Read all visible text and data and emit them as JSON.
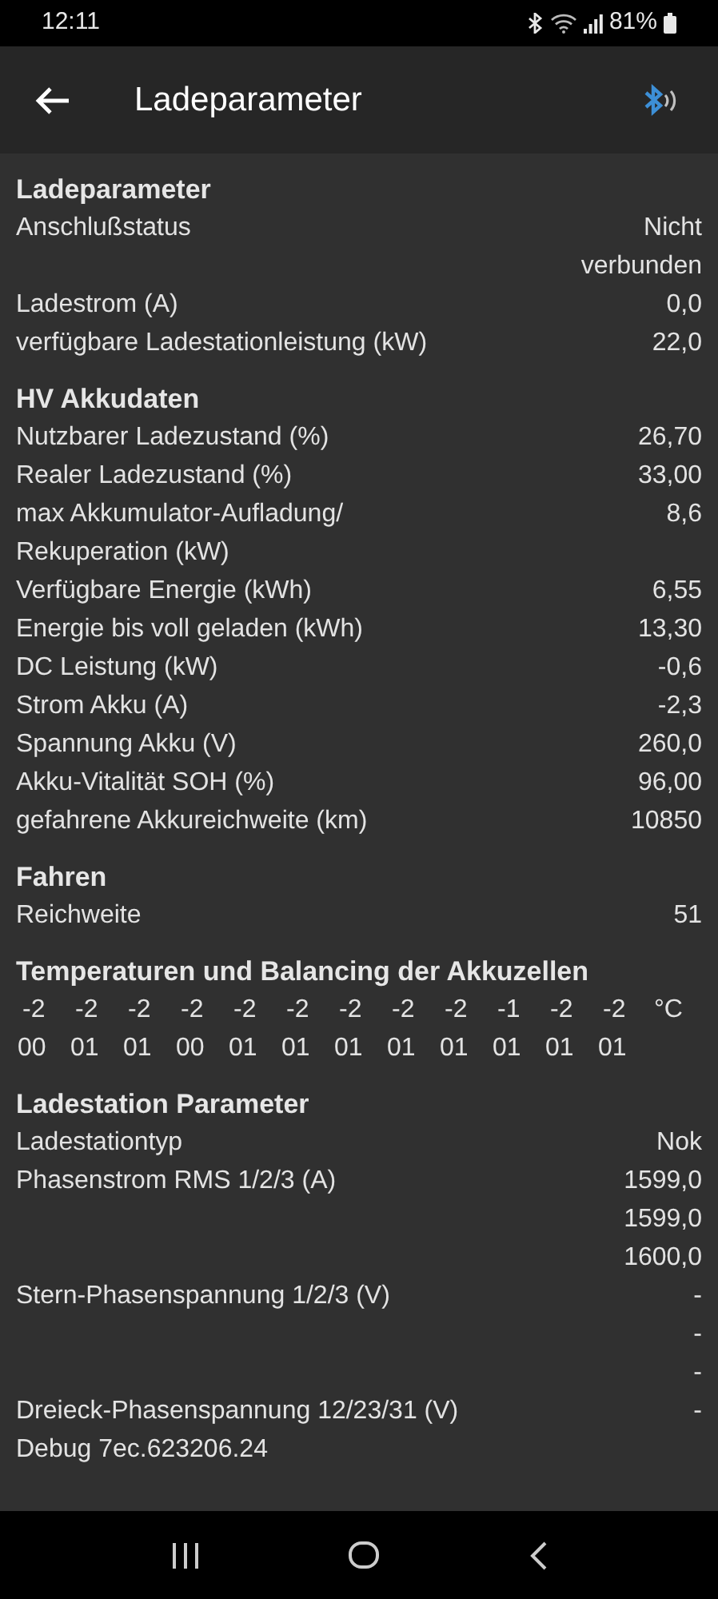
{
  "status_bar": {
    "time": "12:11",
    "battery": "81%"
  },
  "app_bar": {
    "title": "Ladeparameter"
  },
  "sections": [
    {
      "title": "Ladeparameter",
      "rows": [
        {
          "label": "Anschlußstatus",
          "values": [
            "Nicht verbunden"
          ]
        },
        {
          "label": "Ladestrom (A)",
          "values": [
            "0,0"
          ]
        },
        {
          "label": "verfügbare Ladestationleistung (kW)",
          "values": [
            "22,0"
          ]
        }
      ]
    },
    {
      "title": "HV Akkudaten",
      "rows": [
        {
          "label": "Nutzbarer Ladezustand (%)",
          "values": [
            "26,70"
          ]
        },
        {
          "label": "Realer Ladezustand (%)",
          "values": [
            "33,00"
          ]
        },
        {
          "label": "max Akkumulator-Aufladung/ Rekuperation (kW)",
          "values": [
            "8,6"
          ]
        },
        {
          "label": "Verfügbare Energie (kWh)",
          "values": [
            "6,55"
          ]
        },
        {
          "label": "Energie bis voll geladen (kWh)",
          "values": [
            "13,30"
          ]
        },
        {
          "label": "DC Leistung (kW)",
          "values": [
            "-0,6"
          ]
        },
        {
          "label": "Strom Akku (A)",
          "values": [
            "-2,3"
          ]
        },
        {
          "label": "Spannung Akku (V)",
          "values": [
            "260,0"
          ]
        },
        {
          "label": "Akku-Vitalität SOH (%)",
          "values": [
            "96,00"
          ]
        },
        {
          "label": "gefahrene Akkureichweite (km)",
          "values": [
            "10850"
          ]
        }
      ]
    },
    {
      "title": "Fahren",
      "rows": [
        {
          "label": "Reichweite",
          "values": [
            "51"
          ]
        }
      ]
    },
    {
      "title": "Temperaturen und Balancing der Akkuzellen",
      "cells": [
        {
          "temp": "-2",
          "balancing": "00"
        },
        {
          "temp": "-2",
          "balancing": "01"
        },
        {
          "temp": "-2",
          "balancing": "01"
        },
        {
          "temp": "-2",
          "balancing": "00"
        },
        {
          "temp": "-2",
          "balancing": "01"
        },
        {
          "temp": "-2",
          "balancing": "01"
        },
        {
          "temp": "-2",
          "balancing": "01"
        },
        {
          "temp": "-2",
          "balancing": "01"
        },
        {
          "temp": "-2",
          "balancing": "01"
        },
        {
          "temp": "-1",
          "balancing": "01"
        },
        {
          "temp": "-2",
          "balancing": "01"
        },
        {
          "temp": "-2",
          "balancing": "01"
        }
      ],
      "unit": "°C"
    },
    {
      "title": "Ladestation Parameter",
      "rows": [
        {
          "label": "Ladestationtyp",
          "values": [
            "Nok"
          ]
        },
        {
          "label": "Phasenstrom RMS 1/2/3 (A)",
          "values": [
            "1599,0",
            "1599,0",
            "1600,0"
          ]
        },
        {
          "label": "Stern-Phasenspannung 1/2/3 (V)",
          "values": [
            "-",
            "-",
            "-"
          ]
        },
        {
          "label": "Dreieck-Phasenspannung 12/23/31 (V)",
          "values": [
            "-"
          ]
        },
        {
          "label": "Debug 7ec.623206.24"
        }
      ]
    }
  ]
}
